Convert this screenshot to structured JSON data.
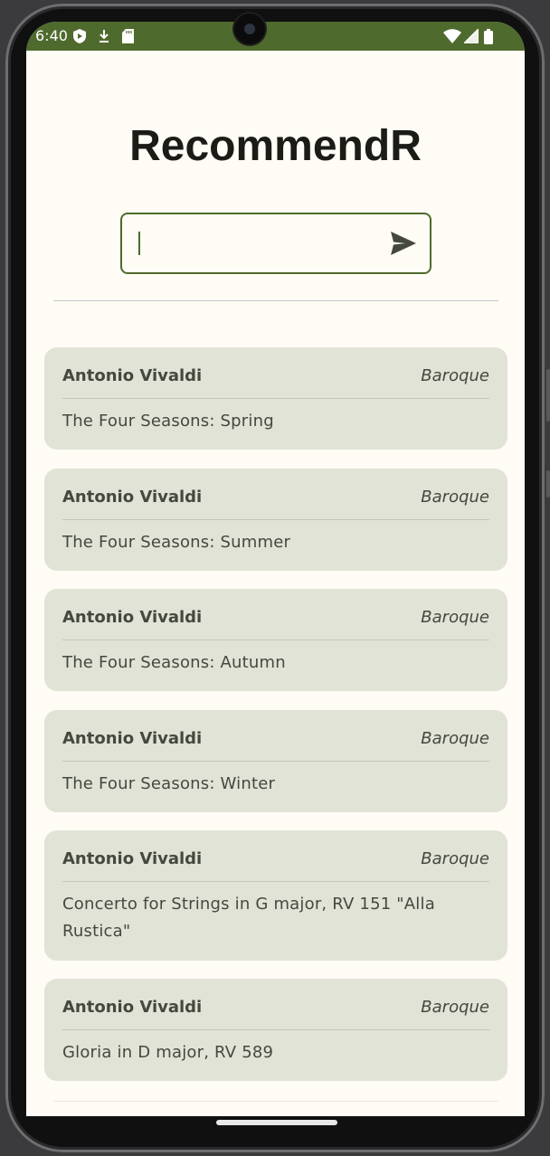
{
  "status": {
    "time": "6:40",
    "icons": [
      "shield-play-icon",
      "download-icon",
      "sd-card-icon",
      "wifi-icon",
      "signal-icon",
      "battery-icon"
    ]
  },
  "app": {
    "title": "RecommendR"
  },
  "search": {
    "value": "",
    "placeholder": ""
  },
  "recommendations": [
    {
      "composer": "Antonio Vivaldi",
      "period": "Baroque",
      "work": "The Four Seasons: Spring"
    },
    {
      "composer": "Antonio Vivaldi",
      "period": "Baroque",
      "work": "The Four Seasons: Summer"
    },
    {
      "composer": "Antonio Vivaldi",
      "period": "Baroque",
      "work": "The Four Seasons: Autumn"
    },
    {
      "composer": "Antonio Vivaldi",
      "period": "Baroque",
      "work": "The Four Seasons: Winter"
    },
    {
      "composer": "Antonio Vivaldi",
      "period": "Baroque",
      "work": "Concerto for Strings in G major, RV 151 \"Alla Rustica\""
    },
    {
      "composer": "Antonio Vivaldi",
      "period": "Baroque",
      "work": "Gloria in D major, RV 589"
    }
  ],
  "colors": {
    "accent": "#4f6a2d",
    "card": "#e0e3d6",
    "background": "#fefcf4"
  }
}
